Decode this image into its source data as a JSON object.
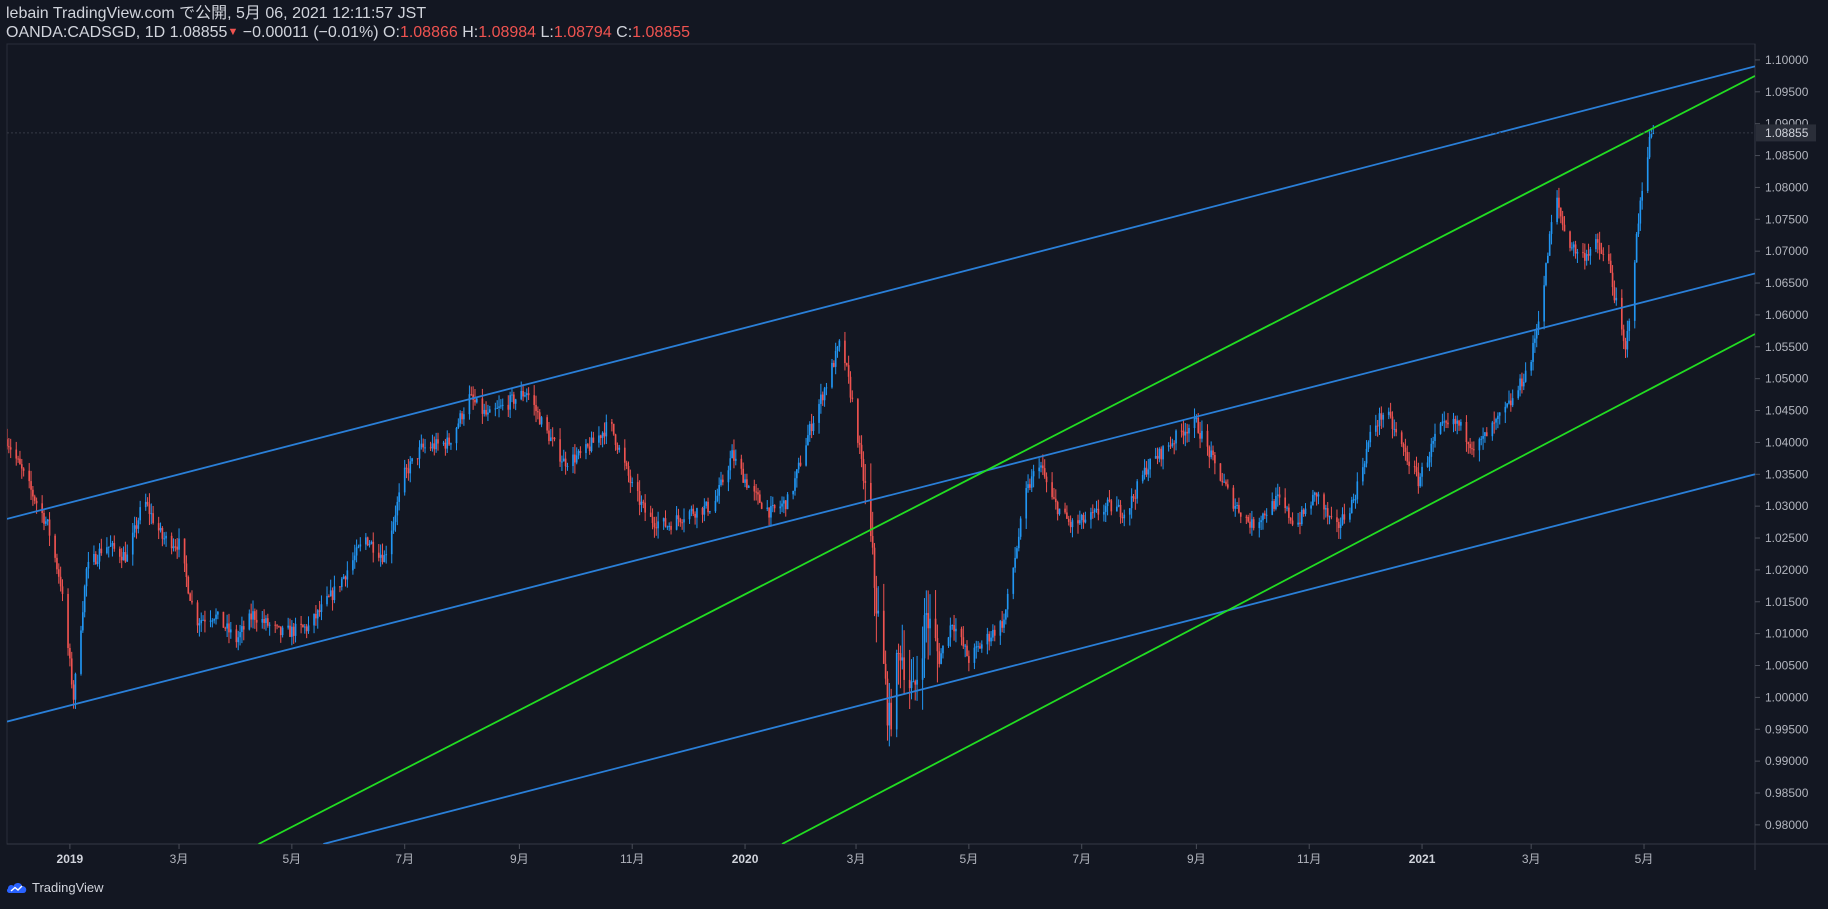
{
  "header": {
    "publish_line": "lebain TradingView.com で公開, 5月 06, 2021 12:11:57 JST",
    "symbol": "OANDA:CADSGD, 1D",
    "last": "1.08855",
    "change": "−0.00011 (−0.01%)",
    "o_label": "O:",
    "o_value": "1.08866",
    "h_label": "H:",
    "h_value": "1.08984",
    "l_label": "L:",
    "l_value": "1.08794",
    "c_label": "C:",
    "c_value": "1.08855"
  },
  "footer": {
    "brand": "TradingView"
  },
  "colors": {
    "background": "#131722",
    "up": "#2196f3",
    "down": "#ef5350",
    "channel_blue": "#2a7fd8",
    "channel_green": "#22dd22",
    "price_tag_bg": "#2a2e39"
  },
  "chart_data": {
    "type": "candlestick",
    "symbol": "OANDA:CADSGD",
    "interval": "1D",
    "ylim": [
      0.977,
      1.1025
    ],
    "y_ticks": [
      "1.10000",
      "1.09500",
      "1.09000",
      "1.08500",
      "1.08000",
      "1.07500",
      "1.07000",
      "1.06500",
      "1.06000",
      "1.05500",
      "1.05000",
      "1.04500",
      "1.04000",
      "1.03500",
      "1.03000",
      "1.02500",
      "1.02000",
      "1.01500",
      "1.01000",
      "1.00500",
      "1.00000",
      "0.99500",
      "0.99000",
      "0.98500",
      "0.98000"
    ],
    "last_price_label": "1.08855",
    "last_price": 1.08855,
    "x_ticks": [
      {
        "label": "2019",
        "year": true,
        "date": "2019-01-01"
      },
      {
        "label": "3月",
        "year": false,
        "date": "2019-03-01"
      },
      {
        "label": "5月",
        "year": false,
        "date": "2019-05-01"
      },
      {
        "label": "7月",
        "year": false,
        "date": "2019-07-01"
      },
      {
        "label": "9月",
        "year": false,
        "date": "2019-09-01"
      },
      {
        "label": "11月",
        "year": false,
        "date": "2019-11-01"
      },
      {
        "label": "2020",
        "year": true,
        "date": "2020-01-01"
      },
      {
        "label": "3月",
        "year": false,
        "date": "2020-03-01"
      },
      {
        "label": "5月",
        "year": false,
        "date": "2020-05-01"
      },
      {
        "label": "7月",
        "year": false,
        "date": "2020-07-01"
      },
      {
        "label": "9月",
        "year": false,
        "date": "2020-09-01"
      },
      {
        "label": "11月",
        "year": false,
        "date": "2020-11-01"
      },
      {
        "label": "2021",
        "year": true,
        "date": "2021-01-01"
      },
      {
        "label": "3月",
        "year": false,
        "date": "2021-03-01"
      },
      {
        "label": "5月",
        "year": false,
        "date": "2021-05-01"
      }
    ],
    "price_path": [
      [
        "2018-11-28",
        1.0405
      ],
      [
        "2018-12-10",
        1.033
      ],
      [
        "2018-12-20",
        1.027
      ],
      [
        "2018-12-27",
        1.018
      ],
      [
        "2019-01-03",
        1.0
      ],
      [
        "2019-01-10",
        1.02
      ],
      [
        "2019-01-20",
        1.024
      ],
      [
        "2019-02-01",
        1.022
      ],
      [
        "2019-02-10",
        1.031
      ],
      [
        "2019-02-20",
        1.025
      ],
      [
        "2019-03-01",
        1.024
      ],
      [
        "2019-03-10",
        1.012
      ],
      [
        "2019-03-20",
        1.013
      ],
      [
        "2019-04-01",
        1.009
      ],
      [
        "2019-04-10",
        1.013
      ],
      [
        "2019-04-25",
        1.01
      ],
      [
        "2019-05-10",
        1.011
      ],
      [
        "2019-05-25",
        1.017
      ],
      [
        "2019-06-10",
        1.025
      ],
      [
        "2019-06-20",
        1.022
      ],
      [
        "2019-07-01",
        1.035
      ],
      [
        "2019-07-10",
        1.039
      ],
      [
        "2019-07-25",
        1.04
      ],
      [
        "2019-08-05",
        1.047
      ],
      [
        "2019-08-15",
        1.044
      ],
      [
        "2019-08-25",
        1.046
      ],
      [
        "2019-09-05",
        1.048
      ],
      [
        "2019-09-15",
        1.042
      ],
      [
        "2019-09-25",
        1.037
      ],
      [
        "2019-10-05",
        1.038
      ],
      [
        "2019-10-20",
        1.043
      ],
      [
        "2019-11-01",
        1.033
      ],
      [
        "2019-11-10",
        1.028
      ],
      [
        "2019-11-20",
        1.027
      ],
      [
        "2019-12-01",
        1.029
      ],
      [
        "2019-12-15",
        1.03
      ],
      [
        "2019-12-25",
        1.038
      ],
      [
        "2020-01-05",
        1.032
      ],
      [
        "2020-01-15",
        1.029
      ],
      [
        "2020-01-25",
        1.031
      ],
      [
        "2020-02-05",
        1.042
      ],
      [
        "2020-02-15",
        1.05
      ],
      [
        "2020-02-22",
        1.056
      ],
      [
        "2020-03-01",
        1.043
      ],
      [
        "2020-03-07",
        1.03
      ],
      [
        "2020-03-12",
        1.015
      ],
      [
        "2020-03-19",
        0.996
      ],
      [
        "2020-03-25",
        1.008
      ],
      [
        "2020-04-01",
        1.0
      ],
      [
        "2020-04-08",
        1.013
      ],
      [
        "2020-04-15",
        1.006
      ],
      [
        "2020-04-22",
        1.012
      ],
      [
        "2020-05-01",
        1.006
      ],
      [
        "2020-05-10",
        1.009
      ],
      [
        "2020-05-20",
        1.012
      ],
      [
        "2020-06-01",
        1.032
      ],
      [
        "2020-06-08",
        1.037
      ],
      [
        "2020-06-15",
        1.031
      ],
      [
        "2020-06-25",
        1.027
      ],
      [
        "2020-07-05",
        1.028
      ],
      [
        "2020-07-15",
        1.03
      ],
      [
        "2020-07-25",
        1.029
      ],
      [
        "2020-08-05",
        1.036
      ],
      [
        "2020-08-15",
        1.039
      ],
      [
        "2020-08-25",
        1.042
      ],
      [
        "2020-09-01",
        1.043
      ],
      [
        "2020-09-10",
        1.037
      ],
      [
        "2020-09-20",
        1.031
      ],
      [
        "2020-10-01",
        1.027
      ],
      [
        "2020-10-15",
        1.031
      ],
      [
        "2020-10-25",
        1.027
      ],
      [
        "2020-11-05",
        1.032
      ],
      [
        "2020-11-15",
        1.026
      ],
      [
        "2020-11-25",
        1.031
      ],
      [
        "2020-12-05",
        1.042
      ],
      [
        "2020-12-12",
        1.045
      ],
      [
        "2020-12-20",
        1.04
      ],
      [
        "2020-12-30",
        1.034
      ],
      [
        "2021-01-10",
        1.042
      ],
      [
        "2021-01-20",
        1.043
      ],
      [
        "2021-01-30",
        1.039
      ],
      [
        "2021-02-10",
        1.043
      ],
      [
        "2021-02-20",
        1.047
      ],
      [
        "2021-03-01",
        1.053
      ],
      [
        "2021-03-08",
        1.065
      ],
      [
        "2021-03-14",
        1.079
      ],
      [
        "2021-03-20",
        1.072
      ],
      [
        "2021-03-28",
        1.069
      ],
      [
        "2021-04-05",
        1.071
      ],
      [
        "2021-04-12",
        1.068
      ],
      [
        "2021-04-17",
        1.06
      ],
      [
        "2021-04-21",
        1.054
      ],
      [
        "2021-04-26",
        1.069
      ],
      [
        "2021-05-01",
        1.083
      ],
      [
        "2021-05-05",
        1.08855
      ]
    ],
    "trendlines": [
      {
        "color": "blue",
        "points": [
          [
            "2018-11-28",
            1.028
          ],
          [
            "2021-06-30",
            1.099
          ]
        ]
      },
      {
        "color": "blue",
        "points": [
          [
            "2018-11-28",
            0.9962
          ],
          [
            "2021-06-30",
            1.0665
          ]
        ]
      },
      {
        "color": "blue",
        "points": [
          [
            "2019-05-18",
            0.977
          ],
          [
            "2021-06-30",
            1.035
          ]
        ]
      },
      {
        "color": "green",
        "points": [
          [
            "2019-04-13",
            0.977
          ],
          [
            "2021-06-30",
            1.0975
          ]
        ]
      },
      {
        "color": "green",
        "points": [
          [
            "2020-01-21",
            0.977
          ],
          [
            "2021-06-30",
            1.057
          ]
        ]
      }
    ]
  }
}
